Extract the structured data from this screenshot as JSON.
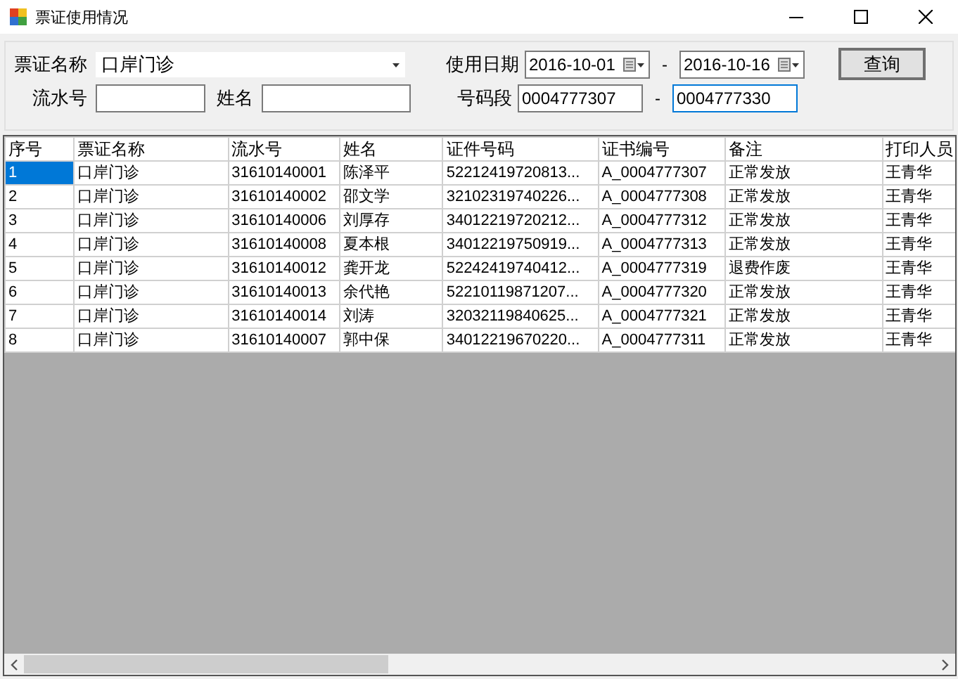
{
  "window": {
    "title": "票证使用情况"
  },
  "form": {
    "ticket_name": {
      "label": "票证名称",
      "value": "口岸门诊"
    },
    "serial": {
      "label": "流水号"
    },
    "name": {
      "label": "姓名"
    },
    "date": {
      "label": "使用日期",
      "from": "2016-10-01",
      "separator": "-",
      "to": "2016-10-16"
    },
    "number_range": {
      "label": "号码段",
      "from": "0004777307",
      "separator": "-",
      "to": "0004777330"
    },
    "query_button": "查询"
  },
  "table": {
    "columns": [
      "序号",
      "票证名称",
      "流水号",
      "姓名",
      "证件号码",
      "证书编号",
      "备注",
      "打印人员"
    ],
    "rows": [
      {
        "selected": true,
        "cells": [
          "1",
          "口岸门诊",
          "31610140001",
          "陈泽平",
          "52212419720813...",
          "A_0004777307",
          "正常发放",
          "王青华"
        ]
      },
      {
        "selected": false,
        "cells": [
          "2",
          "口岸门诊",
          "31610140002",
          "邵文学",
          "32102319740226...",
          "A_0004777308",
          "正常发放",
          "王青华"
        ]
      },
      {
        "selected": false,
        "cells": [
          "3",
          "口岸门诊",
          "31610140006",
          "刘厚存",
          "34012219720212...",
          "A_0004777312",
          "正常发放",
          "王青华"
        ]
      },
      {
        "selected": false,
        "cells": [
          "4",
          "口岸门诊",
          "31610140008",
          "夏本根",
          "34012219750919...",
          "A_0004777313",
          "正常发放",
          "王青华"
        ]
      },
      {
        "selected": false,
        "cells": [
          "5",
          "口岸门诊",
          "31610140012",
          "龚开龙",
          "52242419740412...",
          "A_0004777319",
          "退费作废",
          "王青华"
        ]
      },
      {
        "selected": false,
        "cells": [
          "6",
          "口岸门诊",
          "31610140013",
          "余代艳",
          "52210119871207...",
          "A_0004777320",
          "正常发放",
          "王青华"
        ]
      },
      {
        "selected": false,
        "cells": [
          "7",
          "口岸门诊",
          "31610140014",
          "刘涛",
          "32032119840625...",
          "A_0004777321",
          "正常发放",
          "王青华"
        ]
      },
      {
        "selected": false,
        "cells": [
          "8",
          "口岸门诊",
          "31610140007",
          "郭中保",
          "34012219670220...",
          "A_0004777311",
          "正常发放",
          "王青华"
        ]
      }
    ]
  }
}
